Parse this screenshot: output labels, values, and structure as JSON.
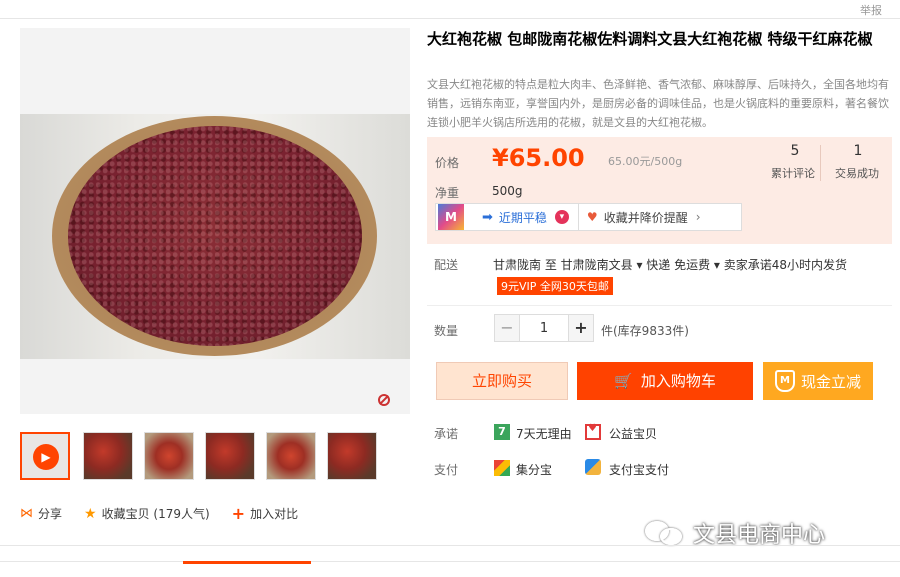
{
  "header": {
    "report_label": "举报"
  },
  "product": {
    "title": "大红袍花椒 包邮陇南花椒佐料调料文县大红袍花椒 特级干红麻花椒",
    "description": "文县大红袍花椒的特点是粒大肉丰、色泽鲜艳、香气浓郁、麻味醇厚、后味持久，全国各地均有销售，远销东南亚，享誉国内外，是厨房必备的调味佳品，也是火锅底料的重要原料，著名餐饮连锁小肥羊火锅店所选用的花椒，就是文县的大红袍花椒。"
  },
  "price": {
    "label": "价格",
    "value": "¥65.00",
    "unit_price": "65.00元/500g",
    "review_count": "5",
    "review_label": "累计评论",
    "deal_count": "1",
    "deal_label": "交易成功",
    "net_label": "净重",
    "net_value": "500g",
    "trend_text": "近期平稳",
    "alert_text": "收藏并降价提醒"
  },
  "shipping": {
    "label": "配送",
    "text": "甘肃陇南 至  甘肃陇南文县  ▾    快递 免运费  ▾     卖家承诺48小时内发货",
    "vip_tag": "9元VIP 全网30天包邮"
  },
  "quantity": {
    "label": "数量",
    "value": "1",
    "minus": "−",
    "plus": "+",
    "stock": "件(库存9833件)"
  },
  "actions": {
    "buy_now": "立即购买",
    "add_cart": "加入购物车",
    "cash_discount": "现金立减"
  },
  "promise": {
    "label": "承诺",
    "item1": "7天无理由",
    "item2": "公益宝贝",
    "item1_icon_text": "7"
  },
  "payment": {
    "label": "支付",
    "item1": "集分宝",
    "item2": "支付宝支付"
  },
  "share_row": {
    "share": "分享",
    "favorite": "收藏宝贝 (179人气)",
    "compare": "加入对比"
  },
  "watermark": {
    "text": "文县电商中心"
  },
  "icons": [
    "report",
    "zoom-icon",
    "play-icon",
    "share-icon",
    "star-icon",
    "plus-icon",
    "m-logo-icon",
    "arrow-right-icon",
    "down-icon",
    "heart-icon",
    "chevron-right-icon",
    "cart-icon",
    "shield-icon",
    "seven-day-icon",
    "charity-icon",
    "jifenbao-icon",
    "alipay-icon",
    "wechat-icon"
  ],
  "colors": {
    "accent": "#ff4400",
    "price_bg": "#fdebe4",
    "cash_btn": "#ffa820"
  }
}
